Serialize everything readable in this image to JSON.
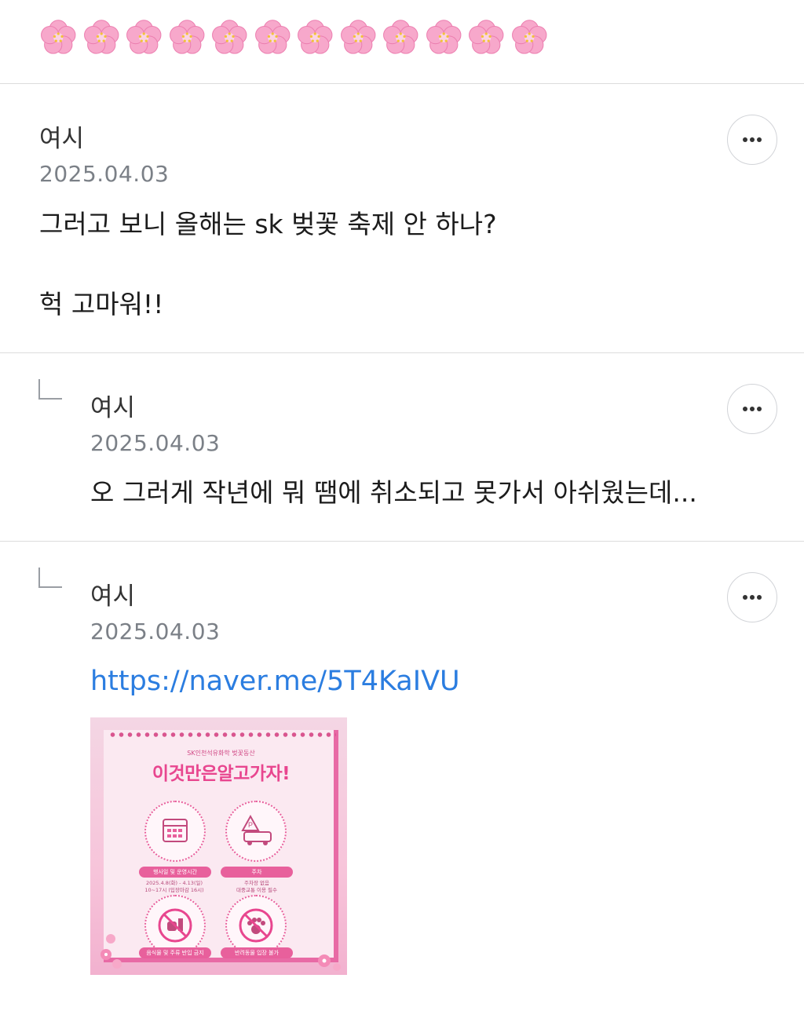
{
  "top": {
    "emoji_glyph": "🌸",
    "emoji_count": 12,
    "emoji_icon": "cherry-blossom-icon"
  },
  "comments": [
    {
      "author": "여시",
      "date": "2025.04.03",
      "body_lines": [
        "그러고 보니 올해는 sk 벚꽃 축제 안 하나?",
        "헉 고마워!!"
      ]
    },
    {
      "author": "여시",
      "date": "2025.04.03",
      "body_lines": [
        "오 그러게 작년에 뭐 땜에 취소되고 못가서 아쉬웠는데..."
      ]
    },
    {
      "author": "여시",
      "date": "2025.04.03",
      "link": "https://naver.me/5T4KaIVU",
      "poster": {
        "subtitle": "SK인천석유화학 벚꽃동산",
        "title": "이것만은알고가자!",
        "items": [
          {
            "label": "행사일 및 운영시간",
            "detail_lines": [
              "2025.4.8(화) - 4.13(일)",
              "10~17시 (입장마감 16시)"
            ]
          },
          {
            "label": "주차",
            "detail_lines": [
              "주차장 없음",
              "대중교통 이용 필수"
            ]
          },
          {
            "label": "음식물 및 주류 반입 금지",
            "detail_lines": []
          },
          {
            "label": "반려동물 입장 불가",
            "detail_lines": []
          }
        ]
      }
    }
  ],
  "colors": {
    "link": "#2b7de0",
    "date": "#7b8087",
    "divider": "#dcdcdc",
    "poster_pink": "#e8468f"
  }
}
